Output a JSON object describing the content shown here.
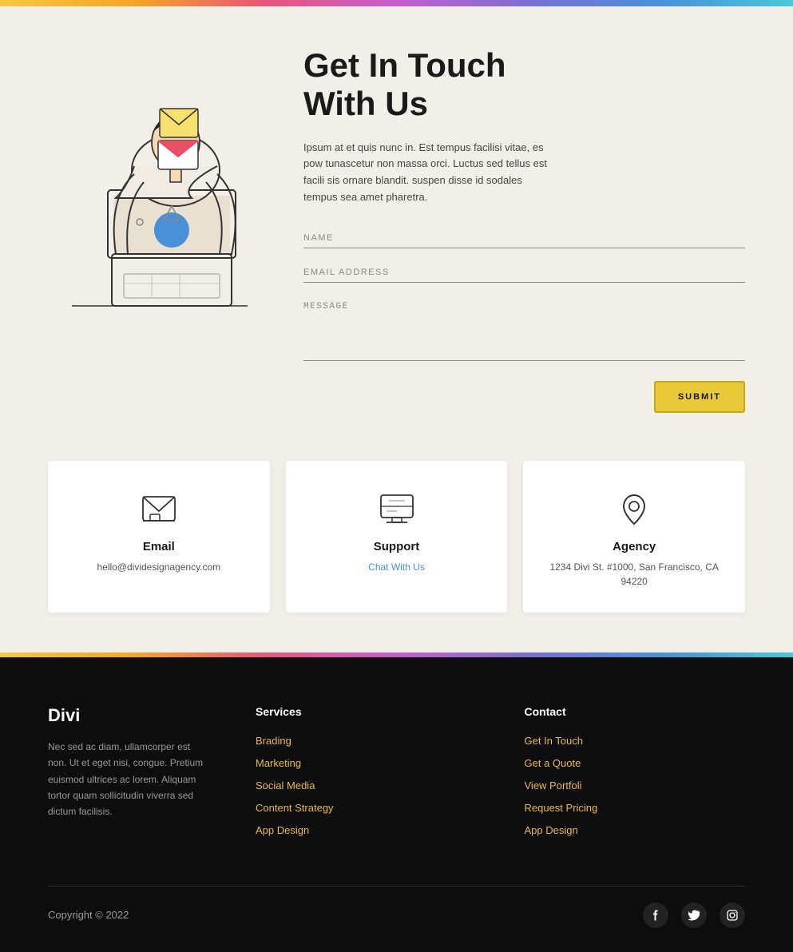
{
  "rainbow_bar": {
    "label": "rainbow-bar"
  },
  "contact_section": {
    "title_line1": "Get In Touch",
    "title_line2": "With Us",
    "description": "Ipsum at et quis nunc in. Est tempus facilisi vitae, es pow tunascetur non massa orci. Luctus sed tellus est facili sis ornare blandit. suspen disse id sodales tempus sea amet pharetra.",
    "form": {
      "name_placeholder": "NAME",
      "email_placeholder": "EMAIL ADDRESS",
      "message_placeholder": "MESSAGE",
      "submit_label": "SUBMIT"
    }
  },
  "cards": [
    {
      "id": "email-card",
      "title": "Email",
      "detail": "hello@dividesignagency.com",
      "link": null,
      "icon": "email"
    },
    {
      "id": "support-card",
      "title": "Support",
      "detail": null,
      "link": "Chat With Us",
      "icon": "support"
    },
    {
      "id": "agency-card",
      "title": "Agency",
      "detail": "1234 Divi St. #1000, San Francisco, CA 94220",
      "link": null,
      "icon": "location"
    }
  ],
  "footer": {
    "logo": "Divi",
    "brand_text": "Nec sed ac diam, ullamcorper est non. Ut et eget nisi, congue. Pretium euismod ultrices ac lorem. Aliquam tortor quam sollicitudin viverra sed dictum facilisis.",
    "services": {
      "title": "Services",
      "links": [
        "Brading",
        "Marketing",
        "Social Media",
        "Content Strategy",
        "App Design"
      ]
    },
    "contact": {
      "title": "Contact",
      "links": [
        "Get In Touch",
        "Get a Quote",
        "View Portfoli",
        "Request Pricing",
        "App Design"
      ]
    },
    "copyright": "Copyright © 2022",
    "social": [
      {
        "name": "facebook",
        "icon": "f"
      },
      {
        "name": "twitter",
        "icon": "𝕏"
      },
      {
        "name": "instagram",
        "icon": "📷"
      }
    ]
  }
}
